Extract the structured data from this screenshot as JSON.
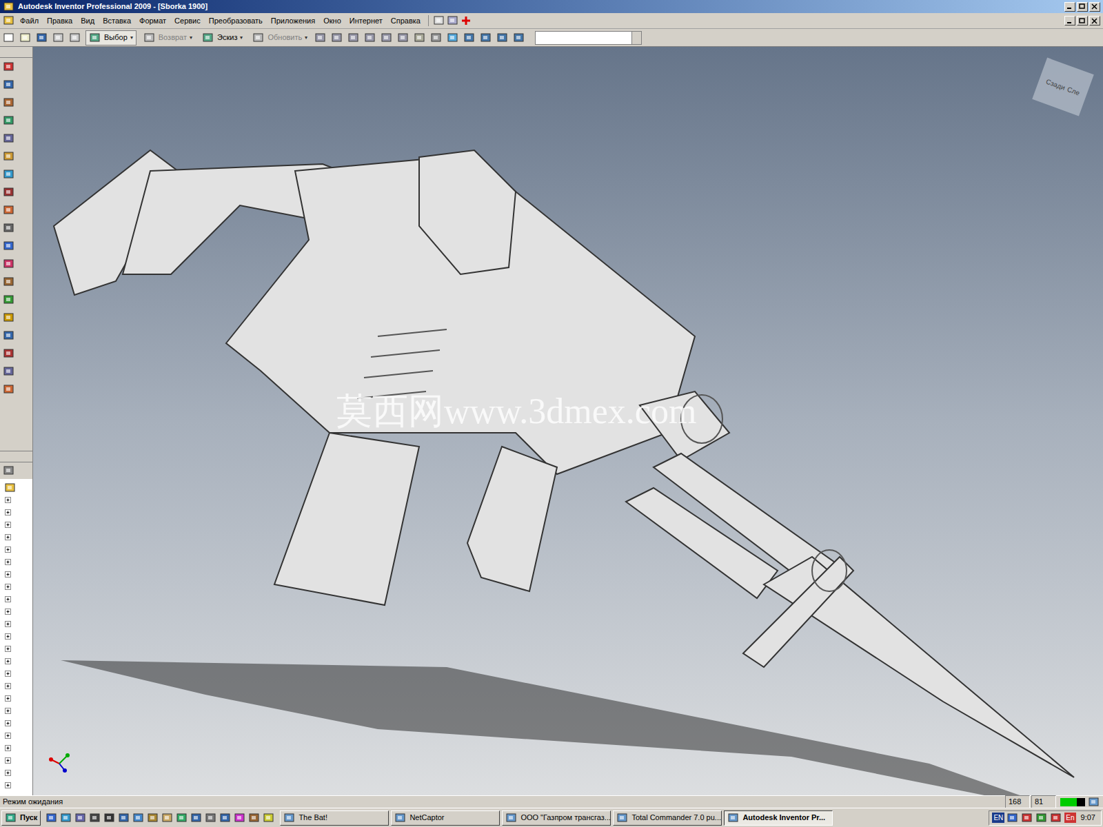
{
  "window": {
    "title": "Autodesk Inventor Professional 2009 - [Sborka 1900]"
  },
  "menu": [
    "Файл",
    "Правка",
    "Вид",
    "Вставка",
    "Формат",
    "Сервис",
    "Преобразовать",
    "Приложения",
    "Окно",
    "Интернет",
    "Справка"
  ],
  "toolbar": [
    {
      "label": "Выбор",
      "disabled": false
    },
    {
      "label": "Возврат",
      "disabled": true
    },
    {
      "label": "Эскиз",
      "disabled": false
    },
    {
      "label": "Обновить",
      "disabled": true
    }
  ],
  "viewcube": [
    "Сзади",
    "Сле"
  ],
  "watermark": "莫西网www.3dmex.com",
  "status_bar": {
    "text": "Режим ожидания",
    "readouts": [
      "168",
      "81"
    ]
  },
  "taskbar": {
    "start": "Пуск",
    "tasks": [
      {
        "label": "The Bat!",
        "active": false
      },
      {
        "label": "NetCaptor",
        "active": false
      },
      {
        "label": "ООО \"Газпром трансгаз...",
        "active": false
      },
      {
        "label": "Total Commander 7.0 pu...",
        "active": false
      },
      {
        "label": "Autodesk Inventor Pr...",
        "active": true
      }
    ],
    "tray": [
      "EN",
      "En"
    ],
    "clock": "9:07"
  }
}
